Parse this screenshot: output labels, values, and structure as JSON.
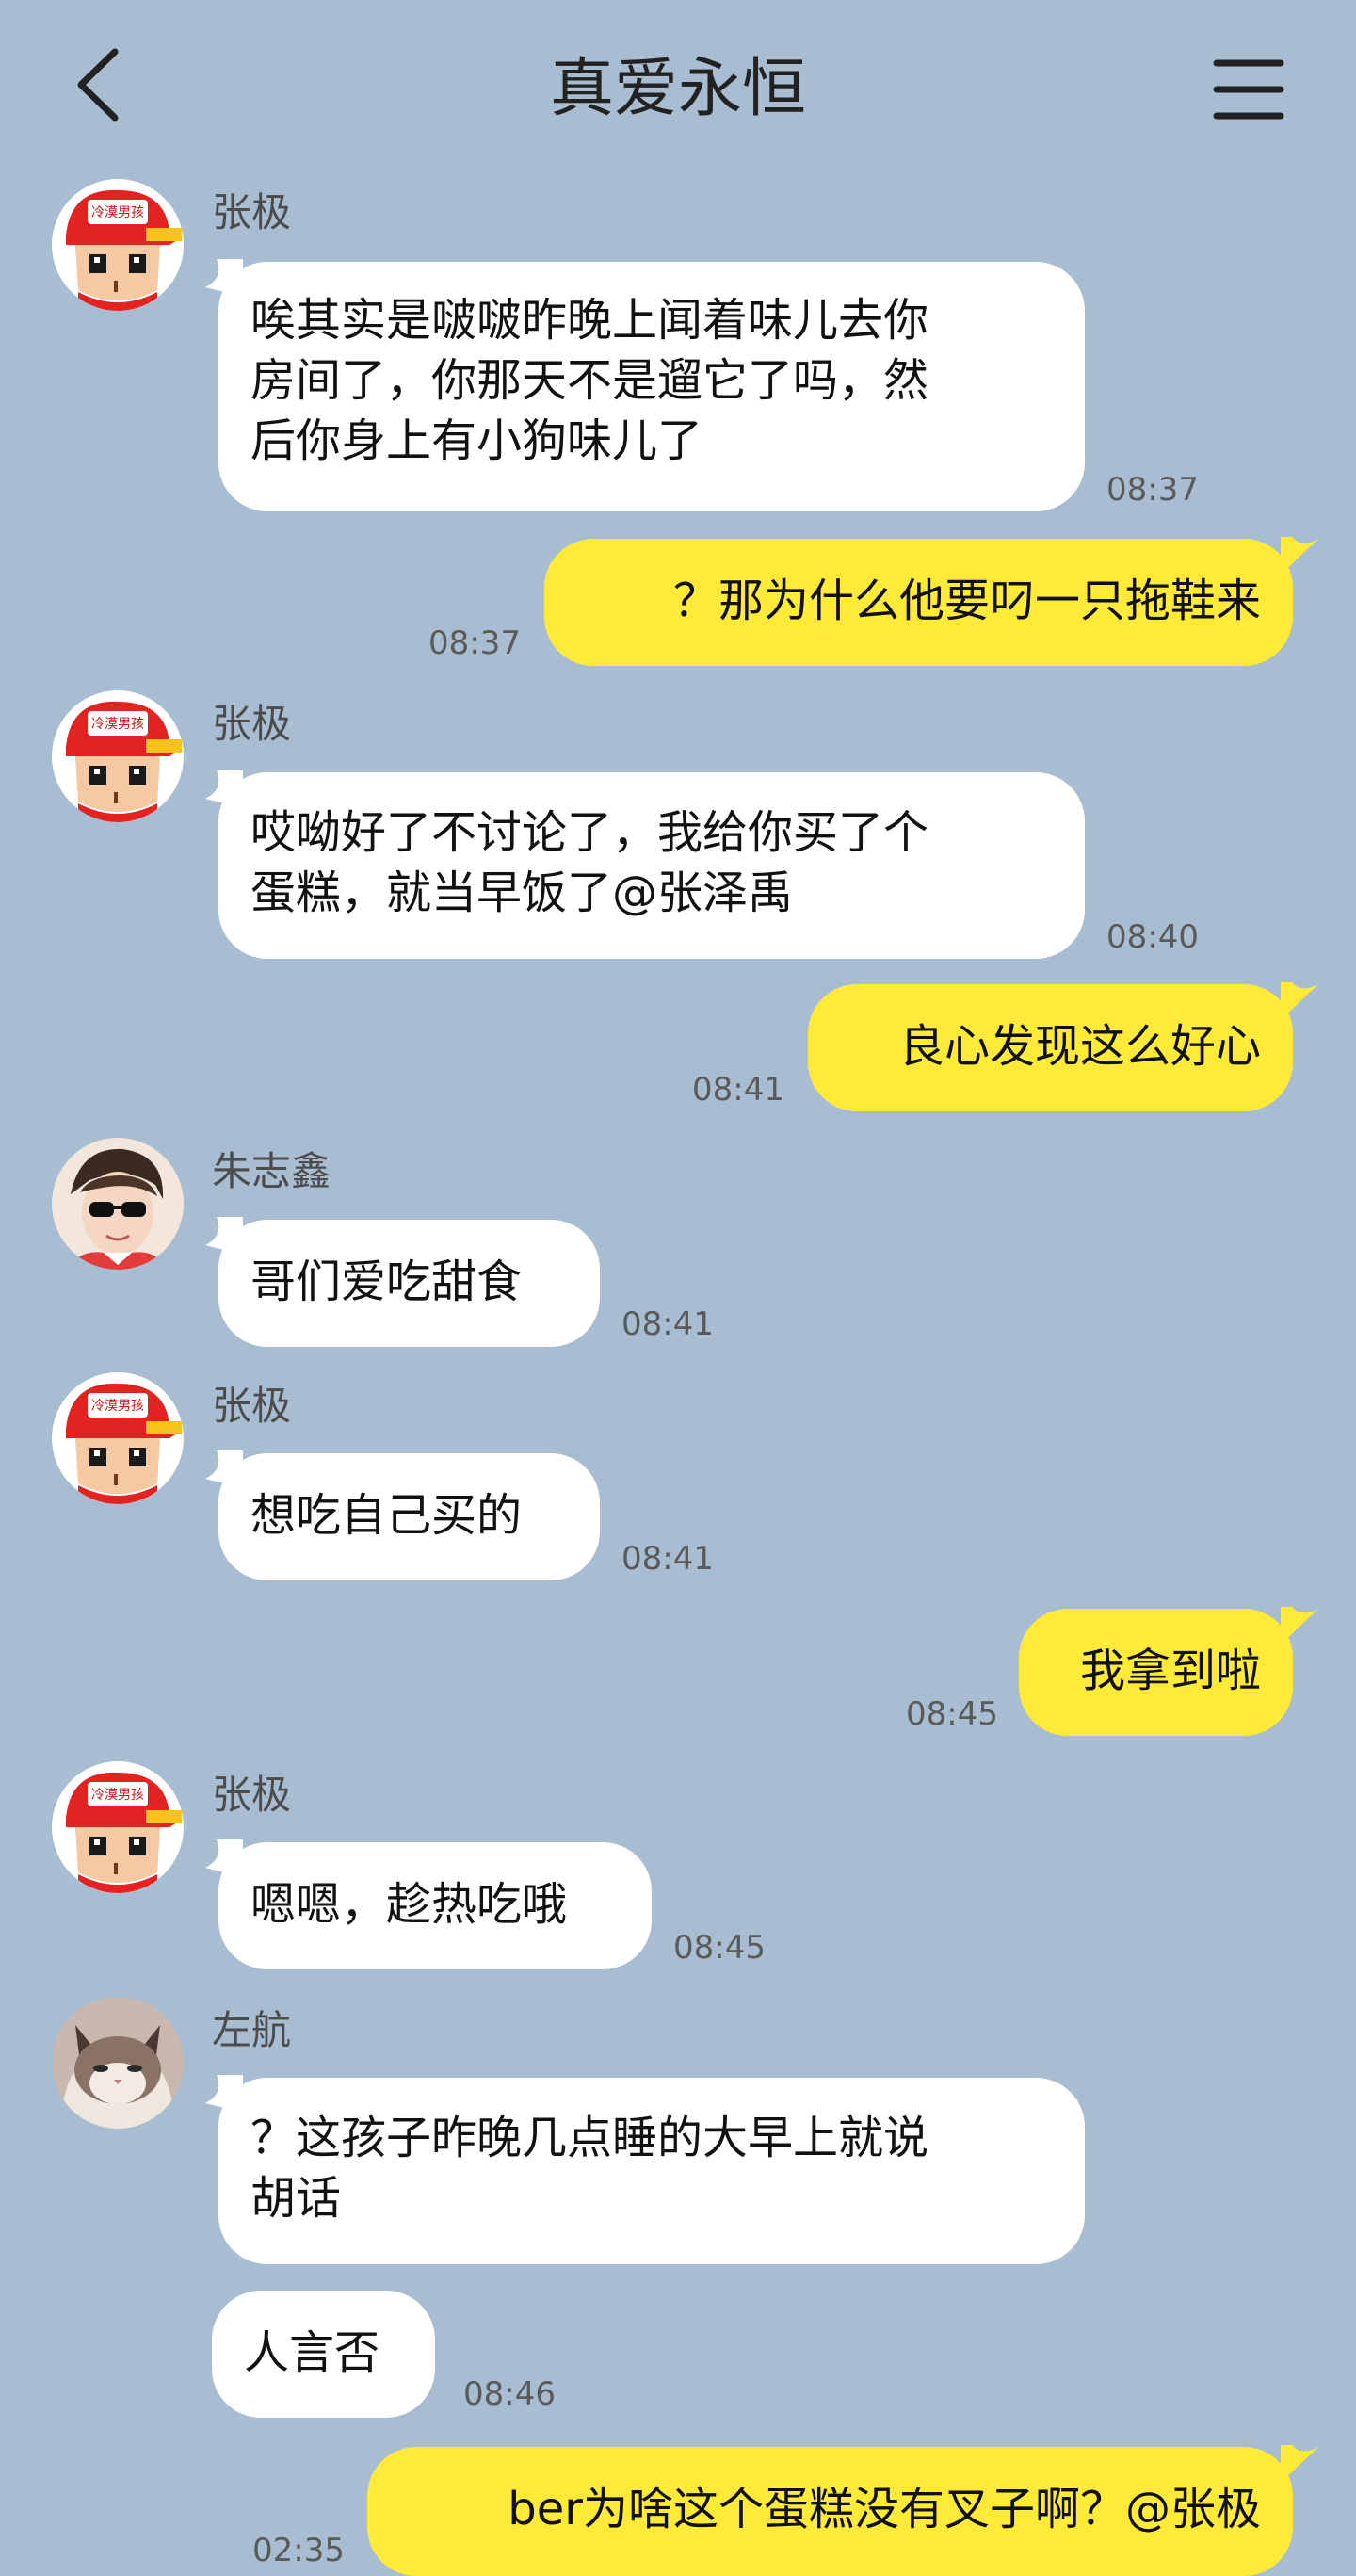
{
  "header": {
    "title": "真爱永恒",
    "back_icon": "chevron-left-icon",
    "menu_icon": "hamburger-menu-icon"
  },
  "colors": {
    "background": "#a8bdd1",
    "incoming_bubble": "#ffffff",
    "outgoing_bubble": "#ffea3a"
  },
  "avatars": {
    "zhangji": {
      "label": "冷漠男孩"
    }
  },
  "messages": [
    {
      "sender": "张极",
      "lines": [
        "唉其实是啵啵昨晚上闻着味儿去你",
        "房间了，你那天不是遛它了吗，然",
        "后你身上有小狗味儿了"
      ],
      "time": "08:37"
    },
    {
      "lines": [
        "？那为什么他要叼一只拖鞋来"
      ],
      "time": "08:37"
    },
    {
      "sender": "张极",
      "lines": [
        "哎呦好了不讨论了，我给你买了个",
        "蛋糕，就当早饭了@张泽禹"
      ],
      "time": "08:40"
    },
    {
      "lines": [
        "良心发现这么好心"
      ],
      "time": "08:41"
    },
    {
      "sender": "朱志鑫",
      "lines": [
        "哥们爱吃甜食"
      ],
      "time": "08:41"
    },
    {
      "sender": "张极",
      "lines": [
        "想吃自己买的"
      ],
      "time": "08:41"
    },
    {
      "lines": [
        "我拿到啦"
      ],
      "time": "08:45"
    },
    {
      "sender": "张极",
      "lines": [
        "嗯嗯，趁热吃哦"
      ],
      "time": "08:45"
    },
    {
      "sender": "左航",
      "lines": [
        "？这孩子昨晚几点睡的大早上就说",
        "胡话"
      ]
    },
    {
      "lines": [
        "人言否"
      ],
      "time": "08:46"
    },
    {
      "lines": [
        "ber为啥这个蛋糕没有叉子啊？@张极"
      ],
      "time": "02:35"
    }
  ]
}
